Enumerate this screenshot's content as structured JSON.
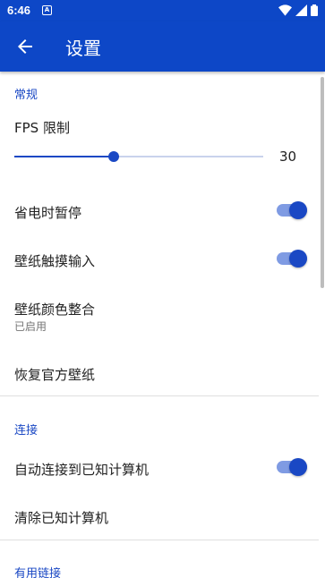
{
  "status_bar": {
    "time": "6:46",
    "notification_icon": "a-notification-icon",
    "system_icons": [
      "wifi-icon",
      "signal-icon",
      "battery-icon"
    ]
  },
  "app_bar": {
    "back_icon": "arrow-left-icon",
    "title": "设置"
  },
  "sections": {
    "general": {
      "header": "常规",
      "fps_limit": {
        "title": "FPS 限制",
        "value": "30",
        "slider_fraction": 0.4
      },
      "power_save_pause": {
        "title": "省电时暂停",
        "enabled": true
      },
      "wallpaper_touch_input": {
        "title": "壁纸触摸输入",
        "enabled": true
      },
      "wallpaper_color_integration": {
        "title": "壁纸颜色整合",
        "summary": "已启用"
      },
      "restore_official_wallpaper": {
        "title": "恢复官方壁纸"
      }
    },
    "connection": {
      "header": "连接",
      "auto_connect": {
        "title": "自动连接到已知计算机",
        "enabled": true
      },
      "clear_known": {
        "title": "清除已知计算机"
      }
    },
    "useful_links": {
      "header": "有用链接"
    }
  },
  "colors": {
    "primary": "#0d47c7",
    "accent": "#1a48c4",
    "switch_track": "#7f9be3",
    "divider": "#e0e0e0"
  }
}
